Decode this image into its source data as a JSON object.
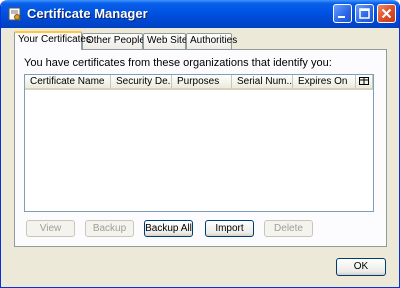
{
  "window": {
    "title": "Certificate Manager",
    "icon": "certificate-icon"
  },
  "tabs": [
    {
      "label": "Your Certificates",
      "selected": true
    },
    {
      "label": "Other People's",
      "selected": false
    },
    {
      "label": "Web Sites",
      "selected": false
    },
    {
      "label": "Authorities",
      "selected": false
    }
  ],
  "panel": {
    "intro_text": "You have certificates from these organizations that identify you:",
    "columns": [
      "Certificate Name",
      "Security De...",
      "Purposes",
      "Serial Num...",
      "Expires On"
    ],
    "column_picker_icon": "column-picker-icon",
    "rows": []
  },
  "buttons": {
    "view": {
      "label": "View",
      "enabled": false
    },
    "backup": {
      "label": "Backup",
      "enabled": false
    },
    "backup_all": {
      "label": "Backup All",
      "enabled": true
    },
    "import": {
      "label": "Import",
      "enabled": true
    },
    "delete": {
      "label": "Delete",
      "enabled": false
    }
  },
  "ok_label": "OK",
  "colors": {
    "titlebar": "#0055e5",
    "window_bg": "#ece9d8",
    "active_tab_accent": "#ffc83c",
    "close_button": "#e0502a"
  }
}
